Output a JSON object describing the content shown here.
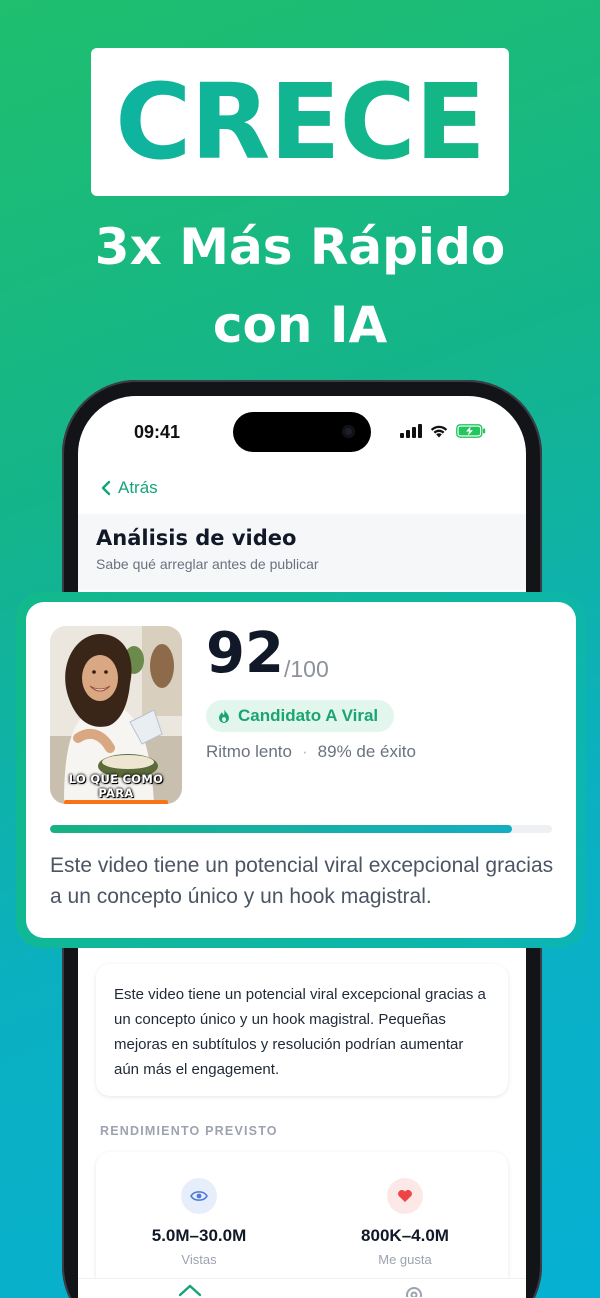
{
  "hero": {
    "headline": "CRECE",
    "subline_1": "3x Más Rápido",
    "subline_2": "con IA"
  },
  "status_bar": {
    "time": "09:41"
  },
  "nav": {
    "back_label": "Atrás"
  },
  "page": {
    "title": "Análisis de video",
    "subtitle": "Sabe qué arreglar antes de publicar"
  },
  "analysis": {
    "thumbnail_caption_line1": "LO QUE COMO",
    "thumbnail_caption_line2": "PARA",
    "score": "92",
    "score_max": "/100",
    "badge": "Candidato A Viral",
    "pace": "Ritmo lento",
    "separator": "·",
    "success": "89% de éxito",
    "progress_fraction": 0.92,
    "description": "Este video tiene un potencial viral excepcional gracias a un concepto único y un hook magistral."
  },
  "summary": {
    "text": "Este video tiene un potencial viral excepcional gracias a un concepto único y un hook magistral. Pequeñas mejoras en subtítulos y resolución podrían aumentar aún más el engagement."
  },
  "performance": {
    "section_label": "RENDIMIENTO PREVISTO",
    "views_value": "5.0M–30.0M",
    "views_label": "Vistas",
    "likes_value": "800K–4.0M",
    "likes_label": "Me gusta"
  },
  "icons": {
    "back": "chevron-left-icon",
    "badge": "flame-icon",
    "views": "eye-icon",
    "likes": "heart-icon",
    "tab_home": "home-icon",
    "tab_settings": "gear-icon"
  },
  "colors": {
    "accent": "#16a37a",
    "badge_bg": "#e3f6ee",
    "likes_red": "#ef4444",
    "views_blue": "#4b7bd6"
  }
}
